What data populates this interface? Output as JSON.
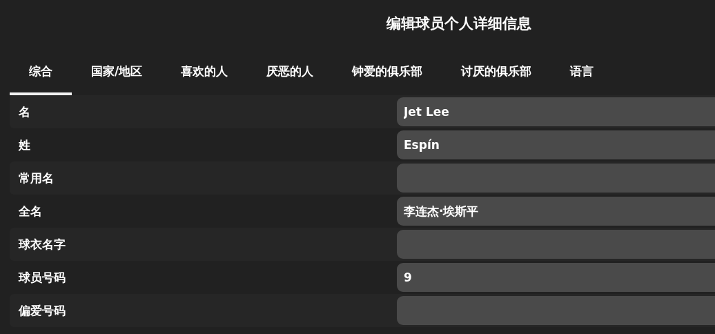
{
  "window": {
    "title": "编辑球员个人详细信息"
  },
  "tabs": [
    {
      "label": "综合",
      "selected": true
    },
    {
      "label": "国家/地区",
      "selected": false
    },
    {
      "label": "喜欢的人",
      "selected": false
    },
    {
      "label": "厌恶的人",
      "selected": false
    },
    {
      "label": "钟爱的俱乐部",
      "selected": false
    },
    {
      "label": "讨厌的俱乐部",
      "selected": false
    },
    {
      "label": "语言",
      "selected": false
    }
  ],
  "fields": [
    {
      "label": "名",
      "value": "Jet Lee"
    },
    {
      "label": "姓",
      "value": "Espín"
    },
    {
      "label": "常用名"
    },
    {
      "label": "全名",
      "value": "李连杰·埃斯平"
    },
    {
      "label": "球衣名字"
    },
    {
      "label": "球员号码",
      "value": "9"
    },
    {
      "label": "偏爱号码"
    }
  ]
}
